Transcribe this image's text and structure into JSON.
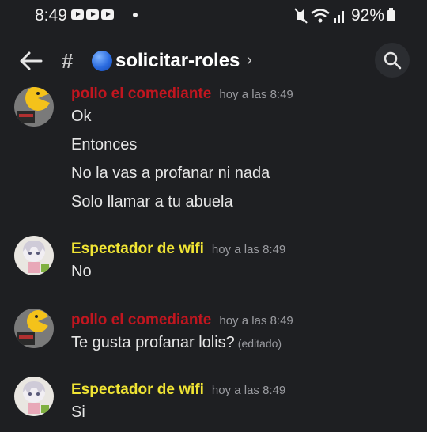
{
  "status_bar": {
    "time": "8:49",
    "battery": "92%"
  },
  "header": {
    "channel_name": "solicitar-roles",
    "hash": "#",
    "chevron": "›"
  },
  "messages": [
    {
      "author": "pollo el comediante",
      "author_color": "#c0161f",
      "timestamp": "hoy a las 8:49",
      "lines": [
        "Ok",
        "Entonces",
        "No la vas a profanar ni nada",
        "Solo llamar a tu abuela"
      ]
    },
    {
      "author": "Espectador de wifi",
      "author_color": "#f0e434",
      "timestamp": "hoy a las 8:49",
      "lines": [
        "No"
      ]
    },
    {
      "author": "pollo el comediante",
      "author_color": "#c0161f",
      "timestamp": "hoy a las 8:49",
      "lines": [
        "Te gusta profanar lolis?"
      ],
      "edited": "(editado)"
    },
    {
      "author": "Espectador de wifi",
      "author_color": "#f0e434",
      "timestamp": "hoy a las 8:49",
      "lines": [
        "Si"
      ]
    }
  ],
  "icons": {
    "back": "back-arrow-icon",
    "search": "search-icon",
    "wifi": "wifi-icon",
    "signal": "signal-icon",
    "mute": "vibrate-mute-icon"
  }
}
